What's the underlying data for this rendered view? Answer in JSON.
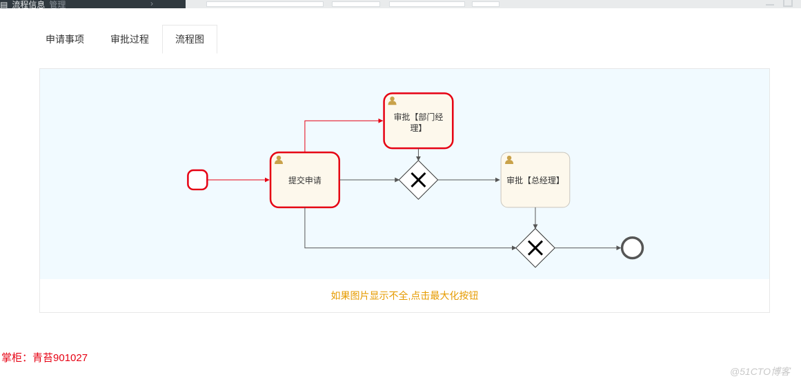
{
  "topbar": {
    "title": "流程信息",
    "subtitle": "管理",
    "arrow": "›"
  },
  "tabs": [
    {
      "label": "申请事项",
      "active": false
    },
    {
      "label": "审批过程",
      "active": false
    },
    {
      "label": "流程图",
      "active": true
    }
  ],
  "flow": {
    "start": "start",
    "end": "end",
    "nodes": {
      "submit": {
        "label": "提交申请"
      },
      "deptMgr": {
        "label_line1": "审批【部门经",
        "label_line2": "理】"
      },
      "gm": {
        "label": "审批【总经理】"
      }
    }
  },
  "hint": "如果图片显示不全,点击最大化按钮",
  "footer": {
    "owner_label": "掌柜：",
    "owner_name": "青苔901027",
    "credit": "@51CTO博客"
  }
}
